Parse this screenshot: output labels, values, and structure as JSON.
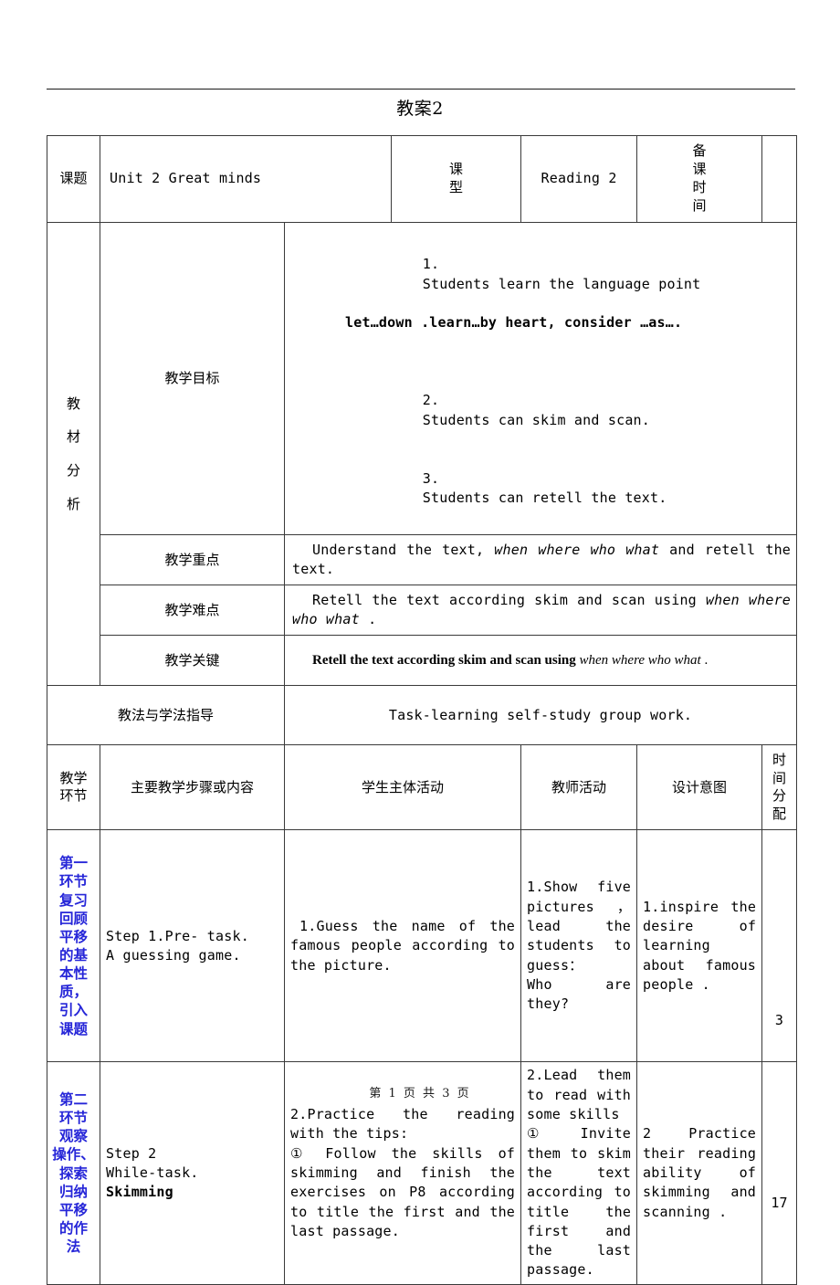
{
  "document": {
    "title": "教案2",
    "footer": "第 1 页 共 3 页"
  },
  "colors": {
    "accent_blue": "#2626d8",
    "text": "#000000",
    "border": "#3a3a3a"
  },
  "header_row": {
    "topic_label": "课题",
    "topic_value": "Unit 2 Great minds",
    "type_label": "课型",
    "type_value": "Reading 2",
    "prep_time_label": "备课时间",
    "prep_time_value": ""
  },
  "analysis": {
    "section_label": "教材分析",
    "rows": [
      {
        "label": "教学目标",
        "items": [
          {
            "num": "1.",
            "text": "Students learn the language point",
            "sub": "let…down .learn…by heart, consider …as….",
            "sub_bold": true
          },
          {
            "num": "2.",
            "text": "Students can skim and scan.",
            "sub": "",
            "sub_bold": false
          },
          {
            "num": "3.",
            "text": "Students can retell the text.",
            "sub": "",
            "sub_bold": false
          }
        ]
      },
      {
        "label": "教学重点",
        "parts": [
          {
            "text": "Understand the text, ",
            "style": "normal"
          },
          {
            "text": "when where who what",
            "style": "italic"
          },
          {
            "text": " and retell the text.",
            "style": "normal"
          }
        ]
      },
      {
        "label": "教学难点",
        "parts": [
          {
            "text": "Retell the text according skim and scan using ",
            "style": "normal"
          },
          {
            "text": "when where who what",
            "style": "italic"
          },
          {
            "text": " .",
            "style": "normal"
          }
        ]
      },
      {
        "label": "教学关键",
        "parts": [
          {
            "text": "Retell the text according skim and scan using ",
            "style": "bold"
          },
          {
            "text": "when where who what",
            "style": "italic"
          },
          {
            "text": " .",
            "style": "normal"
          }
        ]
      }
    ]
  },
  "methods": {
    "label": "教法与学法指导",
    "value": "Task-learning  self-study  group work."
  },
  "table_headers": {
    "stage": "教学环节",
    "steps": "主要教学步骤或内容",
    "student_activity": "学生主体活动",
    "teacher_activity": "教师活动",
    "design_intent": "设计意图",
    "time": "时间分配"
  },
  "stages": [
    {
      "stage_lines": [
        "第一",
        "环节",
        "复习",
        "回顾",
        "平移",
        "的基",
        "本性",
        "质，",
        "引入",
        "课题"
      ],
      "steps": "Step 1.Pre- task.\nA guessing game.",
      "steps_bold_tail": "",
      "student_activity": "1.Guess the name of the famous people according to the picture.",
      "teacher_activity": "1.Show five pictures，lead the students to guess：\nWho are they?",
      "design_intent": "1.inspire the desire of learning about famous people .",
      "time": "3"
    },
    {
      "stage_lines": [
        "第二",
        "环节",
        "观察",
        "操作、",
        "探索",
        "归纳",
        "平移",
        "的作",
        "法"
      ],
      "steps": "Step 2\n  While-task.",
      "steps_bold_tail": "Skimming",
      "student_activity": "2.Practice the reading with the tips:\n① Follow the skills of skimming and finish the exercises on P8 according to title the first and the last passage.",
      "teacher_activity": "2.Lead them to read with some skills\n①Invite them to skim the text according to title the first and the last passage.",
      "design_intent": "2 Practice their reading ability of skimming and scanning .",
      "time": "17"
    }
  ]
}
